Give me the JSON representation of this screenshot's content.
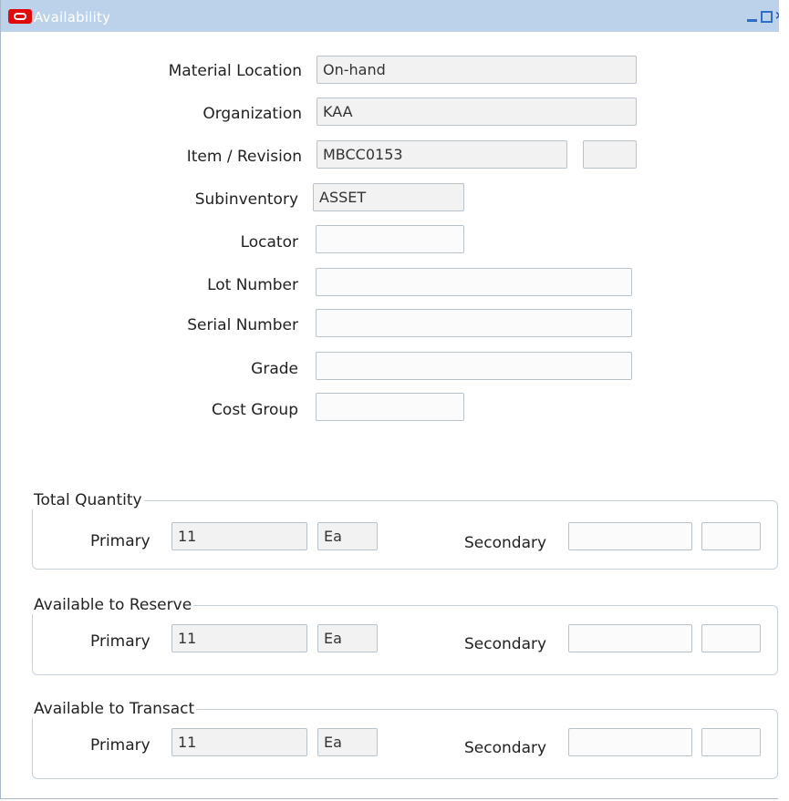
{
  "window": {
    "title": "Availability",
    "controls": [
      "minimize",
      "maximize",
      "close"
    ]
  },
  "form": {
    "material_location": {
      "label": "Material Location",
      "value": "On-hand"
    },
    "organization": {
      "label": "Organization",
      "value": "KAA"
    },
    "item_revision": {
      "label": "Item / Revision",
      "value": "MBCC0153",
      "revision": ""
    },
    "subinventory": {
      "label": "Subinventory",
      "value": "ASSET"
    },
    "locator": {
      "label": "Locator",
      "value": ""
    },
    "lot_number": {
      "label": "Lot Number",
      "value": ""
    },
    "serial_number": {
      "label": "Serial Number",
      "value": ""
    },
    "grade": {
      "label": "Grade",
      "value": ""
    },
    "cost_group": {
      "label": "Cost Group",
      "value": ""
    }
  },
  "quantities": [
    {
      "title": "Total Quantity",
      "primary_label": "Primary",
      "primary_value": "11",
      "primary_uom": "Ea",
      "secondary_label": "Secondary",
      "secondary_value": "",
      "secondary_uom": ""
    },
    {
      "title": "Available to Reserve",
      "primary_label": "Primary",
      "primary_value": "11",
      "primary_uom": "Ea",
      "secondary_label": "Secondary",
      "secondary_value": "",
      "secondary_uom": ""
    },
    {
      "title": "Available to Transact",
      "primary_label": "Primary",
      "primary_value": "11",
      "primary_uom": "Ea",
      "secondary_label": "Secondary",
      "secondary_value": "",
      "secondary_uom": ""
    }
  ],
  "colors": {
    "titlebar": "#bcd2ea",
    "brand_red": "#e10b0b",
    "field_bg": "#f2f2f2"
  }
}
